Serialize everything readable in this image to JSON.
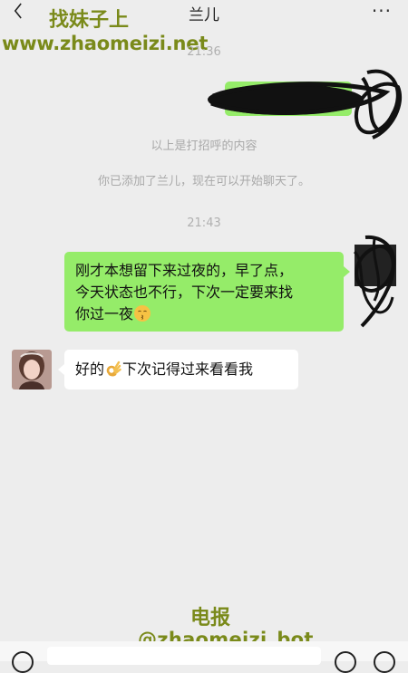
{
  "header": {
    "back_icon": "chevron-left-icon",
    "title": "兰儿",
    "more_icon": "more-dots-icon",
    "more_glyph": "···"
  },
  "watermarks": {
    "top_title": "找妹子上",
    "top_url": "www.zhaomeizi.net",
    "bottom_title": "电报",
    "bottom_handle": "@zhaomeizi_bot"
  },
  "chat": {
    "time_first": "21:36",
    "system_greeting": "以上是打招呼的内容",
    "system_added": "你已添加了兰儿，现在可以开始聊天了。",
    "time_second": "21:43",
    "message_sent": {
      "line1": "刚才本想留下来过夜的，早了点，",
      "line2": "今天状态也不行，下次一定要来找",
      "line3": "你过一夜"
    },
    "message_received": {
      "before_emoji": "好的",
      "after_emoji": "下次记得过来看看我"
    }
  },
  "input_bar": {
    "voice_icon": "voice-icon",
    "emoji_icon": "emoji-icon",
    "plus_icon": "plus-icon"
  },
  "colors": {
    "background": "#ededed",
    "sent_bubble": "#95ec69",
    "received_bubble": "#ffffff",
    "watermark": "#7a8a1a"
  }
}
